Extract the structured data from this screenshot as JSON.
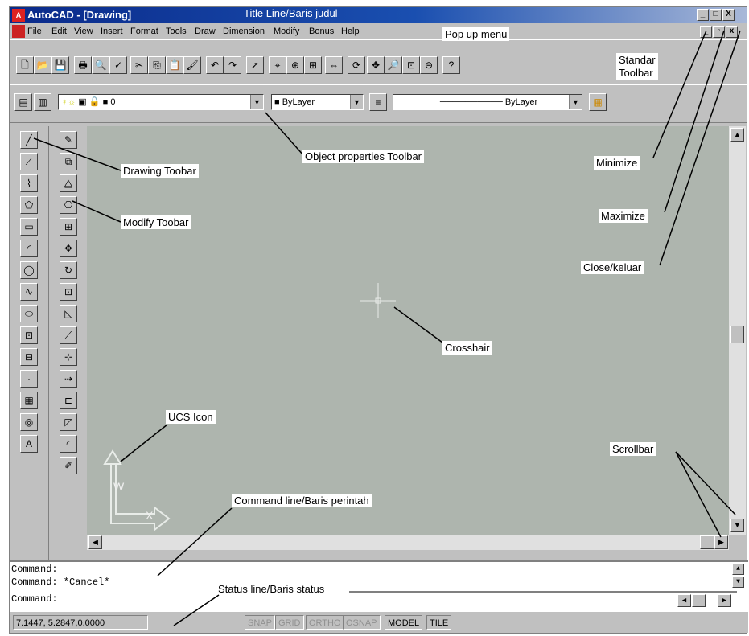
{
  "window": {
    "title": "AutoCAD - [Drawing]",
    "app_icon_text": "A",
    "controls": [
      "_",
      "□",
      "X"
    ],
    "doc_controls": [
      "_",
      "▫",
      "x"
    ]
  },
  "menu": [
    {
      "label": "File"
    },
    {
      "label": "Edit"
    },
    {
      "label": "View"
    },
    {
      "label": "Insert"
    },
    {
      "label": "Format"
    },
    {
      "label": "Tools"
    },
    {
      "label": "Draw"
    },
    {
      "label": "Dimension"
    },
    {
      "label": "Modify"
    },
    {
      "label": "Bonus"
    },
    {
      "label": "Help"
    }
  ],
  "standard_toolbar": {
    "icons": [
      "new-icon",
      "open-icon",
      "save-icon",
      "print-icon",
      "preview-icon",
      "spell-icon",
      "cut-icon",
      "copy-icon",
      "paste-icon",
      "matchprop-icon",
      "undo-icon",
      "redo-icon",
      "launch-icon",
      "snap-icon",
      "tracking-icon",
      "ucs-icon",
      "dist-icon",
      "redraw-icon",
      "pan-icon",
      "zoom-realtime-icon",
      "zoom-window-icon",
      "zoom-previous-icon",
      "help-icon"
    ],
    "glyphs": [
      "🗋",
      "📂",
      "💾",
      "🖶",
      "🔍",
      "✓",
      "✂",
      "⎘",
      "📋",
      "🖌",
      "↶",
      "↷",
      "➚",
      "⌖",
      "⊕",
      "⊞",
      "⇔",
      "⟳",
      "✥",
      "🔎",
      "⊡",
      "⊖",
      "?"
    ]
  },
  "object_properties_toolbar": {
    "layer_value": "0",
    "color_value": "ByLayer",
    "linetype_value": "ByLayer"
  },
  "drawing_toolbar": {
    "icons": [
      "line-icon",
      "construction-line-icon",
      "polyline-icon",
      "polygon-icon",
      "rectangle-icon",
      "arc-icon",
      "circle-icon",
      "spline-icon",
      "ellipse-icon",
      "insert-block-icon",
      "make-block-icon",
      "point-icon",
      "hatch-icon",
      "region-icon",
      "text-icon"
    ],
    "glyphs": [
      "╱",
      "⟋",
      "⌇",
      "⬠",
      "▭",
      "◜",
      "◯",
      "∿",
      "⬭",
      "⊡",
      "⊟",
      "·",
      "▦",
      "◎",
      "A"
    ]
  },
  "modify_toolbar": {
    "icons": [
      "erase-icon",
      "copy-object-icon",
      "mirror-icon",
      "offset-icon",
      "array-icon",
      "move-icon",
      "rotate-icon",
      "scale-icon",
      "stretch-icon",
      "lengthen-icon",
      "trim-icon",
      "extend-icon",
      "break-icon",
      "chamfer-icon",
      "fillet-icon",
      "explode-icon"
    ],
    "glyphs": [
      "✎",
      "⧉",
      "⧋",
      "⎔",
      "⊞",
      "✥",
      "↻",
      "⊡",
      "◺",
      "⟋",
      "⊹",
      "⇢",
      "⊏",
      "◸",
      "◜",
      "✐"
    ]
  },
  "command": {
    "lines": [
      "Command:",
      "Command: *Cancel*",
      "Command:"
    ]
  },
  "status": {
    "coords": "7.1447, 5.2847,0.0000",
    "toggles": [
      {
        "label": "SNAP",
        "on": false
      },
      {
        "label": "GRID",
        "on": false
      },
      {
        "label": "ORTHO",
        "on": false
      },
      {
        "label": "OSNAP",
        "on": false
      },
      {
        "label": "MODEL",
        "on": true
      },
      {
        "label": "TILE",
        "on": true
      }
    ]
  },
  "ucs": {
    "x_label": "X",
    "y_label": "W"
  },
  "annotations": {
    "title_line": "Title Line/Baris judul",
    "popup_menu": "Pop up menu",
    "standard_toolbar": "Standar\nToolbar",
    "object_properties": "Object properties Toolbar",
    "drawing_toolbar": "Drawing Toobar",
    "modify_toolbar": "Modify Toobar",
    "minimize": "Minimize",
    "maximize": "Maximize",
    "close": "Close/keluar",
    "crosshair": "Crosshair",
    "ucs_icon": "UCS Icon",
    "scrollbar": "Scrollbar",
    "command_line": "Command line/Baris perintah",
    "status_line": "Status line/Baris status"
  },
  "colors": {
    "title_bar": "#0a2a8a",
    "drawing_bg": "#aeb5ae",
    "chrome": "#c0c0c0"
  }
}
